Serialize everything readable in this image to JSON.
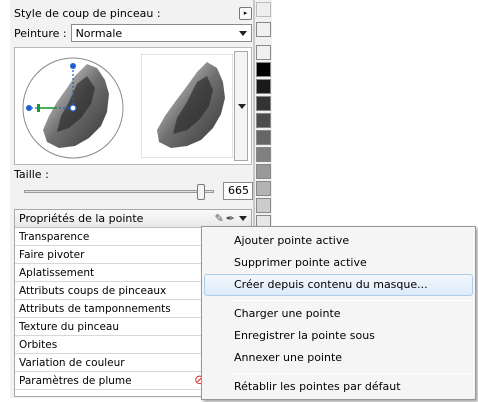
{
  "panel": {
    "brush_style_label": "Style de coup de pinceau :",
    "paint_label": "Peinture :",
    "paint_mode": "Normale",
    "size_label": "Taille :",
    "size_value": "665",
    "size_fraction": 0.95
  },
  "properties": {
    "header": "Propriétés de la pointe",
    "rows": [
      "Transparence",
      "Faire pivoter",
      "Aplatissement",
      "Attributs coups de pinceaux",
      "Attributs de tamponnements",
      "Texture du pinceau",
      "Orbites",
      "Variation de couleur",
      "Paramètres de plume"
    ]
  },
  "context_menu": {
    "items": [
      "Ajouter pointe active",
      "Supprimer pointe active",
      "Créer depuis contenu du masque...",
      "Charger une pointe",
      "Enregistrer la pointe sous",
      "Annexer une pointe",
      "Rétablir les pointes par défaut"
    ],
    "highlighted_index": 2
  },
  "colors": {
    "swatches": [
      "#ffffff",
      "#000000",
      "#1a1a1a",
      "#333333",
      "#4d4d4d",
      "#666666",
      "#808080",
      "#999999",
      "#b3b3b3",
      "#cccccc",
      "#e6e6e6",
      "#ffffff"
    ],
    "menu_highlight": "#dceaf9",
    "dial_handle": "#1f5fcf",
    "dial_marker": "#1f9a2a",
    "no_icon": "#d43030"
  },
  "icons": {
    "style_toggle": "mini-arrow-icon",
    "pin": "pin-icon",
    "brush_tip": "brush-icon",
    "pen": "pen-icon",
    "no_symbol": "no-entry-icon"
  }
}
